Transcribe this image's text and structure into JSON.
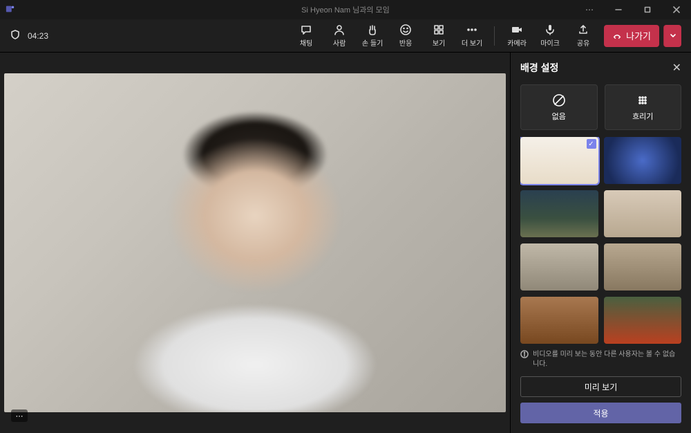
{
  "window": {
    "title": "Si Hyeon Nam 님과의 모임"
  },
  "timer": "04:23",
  "toolbar": {
    "chat": "채팅",
    "people": "사람",
    "raise_hand": "손 들기",
    "reactions": "반응",
    "view": "보기",
    "more": "더 보기",
    "camera": "카메라",
    "mic": "마이크",
    "share": "공유",
    "leave": "나가기"
  },
  "panel": {
    "title": "배경 설정",
    "option_none": "없음",
    "option_blur": "흐리기",
    "info_text": "비디오를 미리 보는 동안 다른 사용자는 볼 수 없습니다.",
    "preview_btn": "미리 보기",
    "apply_btn": "적용",
    "backgrounds": [
      {
        "id": "bg1",
        "name": "white-room",
        "selected": true
      },
      {
        "id": "bg2",
        "name": "space-vortex",
        "selected": false
      },
      {
        "id": "bg3",
        "name": "landscape",
        "selected": false
      },
      {
        "id": "bg4",
        "name": "wood-interior-1",
        "selected": false
      },
      {
        "id": "bg5",
        "name": "wood-interior-2",
        "selected": false
      },
      {
        "id": "bg6",
        "name": "living-room-1",
        "selected": false
      },
      {
        "id": "bg7",
        "name": "living-room-2",
        "selected": false
      },
      {
        "id": "bg8",
        "name": "garden-room",
        "selected": false
      }
    ]
  },
  "colors": {
    "leave": "#c4314b",
    "accent": "#6264a7",
    "selected": "#7b83eb"
  }
}
